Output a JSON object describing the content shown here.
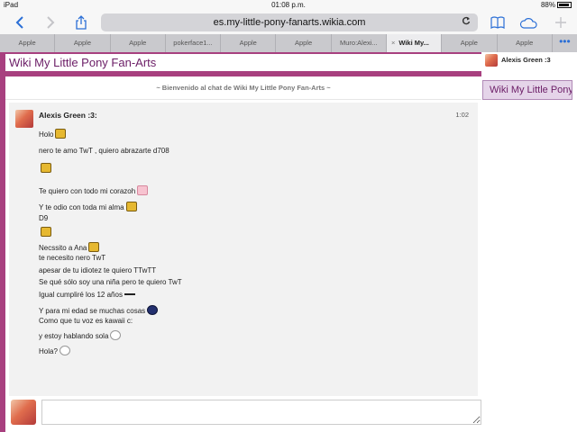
{
  "status": {
    "device": "iPad",
    "time": "01:08 p.m.",
    "battery": "88%"
  },
  "browser": {
    "url": "es.my-little-pony-fanarts.wikia.com",
    "icons": {
      "back": "back-icon",
      "forward": "forward-icon",
      "share": "share-icon",
      "reload": "reload-icon",
      "bookmarks": "bookmarks-icon",
      "cloud": "cloud-icon",
      "new_tab": "plus-icon"
    },
    "tabs": [
      "Apple",
      "Apple",
      "Apple",
      "pokerface1...",
      "Apple",
      "Apple",
      "Muro:Alexi...",
      "Wiki My...",
      "Apple",
      "Apple"
    ],
    "active_tab": 7,
    "tab_close": "×",
    "more": "•••"
  },
  "wiki": {
    "title": "Wiki My Little Pony Fan-Arts"
  },
  "chat": {
    "welcome": "~ Bienvenido al chat de Wiki My Little Pony Fan-Arts ~",
    "message": {
      "user": "Alexis Green :3:",
      "time": "1:02",
      "lines": [
        {
          "text": "Holo",
          "emote": "cat"
        },
        {
          "text": "nero te amo TwT , quiero abrazarte d708",
          "emote": ""
        },
        {
          "text": "",
          "emote": "cat"
        },
        {
          "text": "Te quiero con todo mi corazoh",
          "emote": "pink"
        },
        {
          "text": "Y te odio con toda mi alma",
          "emote": "cat"
        },
        {
          "text": "D9",
          "emote": ""
        },
        {
          "text": "",
          "emote": "cat"
        },
        {
          "text": "Necssito a Ana",
          "emote": "cat"
        },
        {
          "text": "te necesito nero TwT",
          "emote": ""
        },
        {
          "text": "apesar de tu idiotez te quiero TTwTT",
          "emote": ""
        },
        {
          "text": "Se qué sólo soy una niña pero te quiero TwT",
          "emote": ""
        },
        {
          "text": "Igual cumpliré los 12 años",
          "emote": "brow"
        },
        {
          "text": "Y para mi edad se muchas cosas",
          "emote": "blue"
        },
        {
          "text": "Como que tu voz es kawaii c:",
          "emote": ""
        },
        {
          "text": "y estoy hablando sola",
          "emote": "face"
        },
        {
          "text": "Hola?",
          "emote": "face"
        }
      ]
    },
    "input_placeholder": ""
  },
  "sidebar": {
    "user": "Alexis Green :3",
    "room": "Wiki My Little Pony Fan-Arts"
  }
}
